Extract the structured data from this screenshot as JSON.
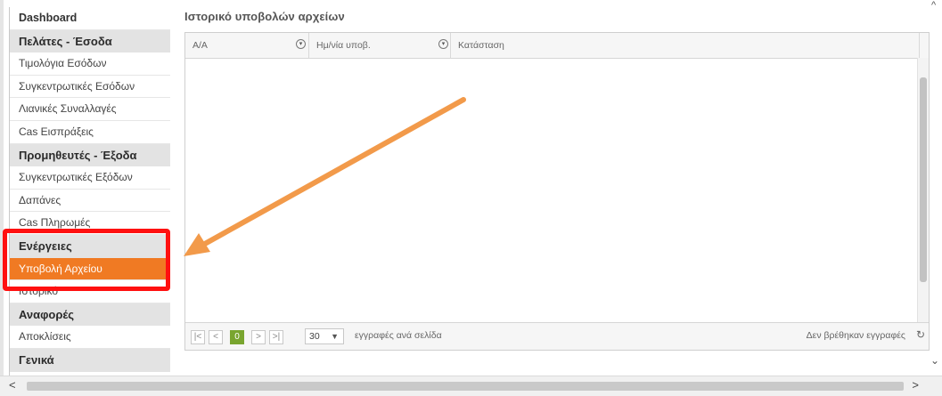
{
  "sidebar": {
    "dashboard": "Dashboard",
    "sections": [
      {
        "header": "Πελάτες - Έσοδα",
        "items": [
          "Τιμολόγια Εσόδων",
          "Συγκεντρωτικές Εσόδων",
          "Λιανικές Συναλλαγές",
          "Cas Εισπράξεις"
        ]
      },
      {
        "header": "Προμηθευτές - Έξοδα",
        "items": [
          "Συγκεντρωτικές Εξόδων",
          "Δαπάνες",
          "Cas Πληρωμές"
        ]
      },
      {
        "header": "Ενέργειες",
        "items": [
          "Υποβολή Αρχείου",
          "Ιστορικό"
        ]
      },
      {
        "header": "Αναφορές",
        "items": [
          "Αποκλίσεις"
        ]
      },
      {
        "header": "Γενικά",
        "items": []
      }
    ],
    "active_item": "Υποβολή Αρχείου"
  },
  "main": {
    "title": "Ιστορικό υποβολών αρχείων",
    "columns": [
      "Α/Α",
      "Ημ/νία υποβ.",
      "Κατάσταση"
    ],
    "pager": {
      "current_page": "0",
      "page_size": "30",
      "per_page_label": "εγγραφές ανά σελίδα",
      "empty_text": "Δεν βρέθηκαν εγγραφές"
    }
  },
  "colors": {
    "accent": "#f07a23",
    "highlight": "#ff1010",
    "pager_active": "#79a52f",
    "arrow": "#f29a4a"
  }
}
